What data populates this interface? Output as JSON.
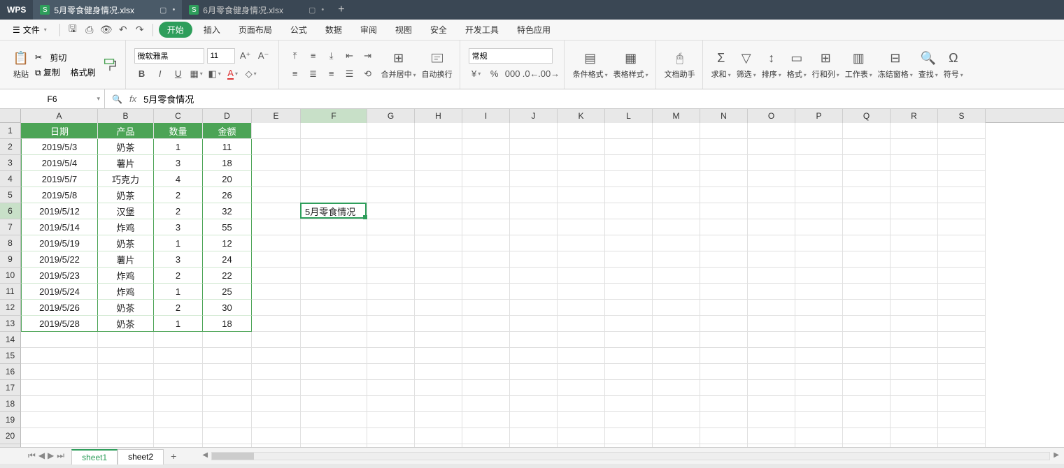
{
  "app": {
    "brand": "WPS"
  },
  "tabs": [
    {
      "label": "5月零食健身情况.xlsx",
      "active": true
    },
    {
      "label": "6月零食健身情况.xlsx",
      "active": false
    }
  ],
  "menu": {
    "file": "文件",
    "items": [
      "开始",
      "插入",
      "页面布局",
      "公式",
      "数据",
      "审阅",
      "视图",
      "安全",
      "开发工具",
      "特色应用"
    ],
    "active": "开始"
  },
  "qat": {
    "cut": "剪切",
    "copy": "复制",
    "format_painter": "格式刷",
    "paste": "粘贴"
  },
  "ribbon": {
    "font_name": "微软雅黑",
    "font_size": "11",
    "merge": "合并居中",
    "wrap": "自动换行",
    "number_format": "常规",
    "cond_fmt": "条件格式",
    "table_style": "表格样式",
    "doc_helper": "文档助手",
    "sum": "求和",
    "filter": "筛选",
    "sort": "排序",
    "format": "格式",
    "rowcol": "行和列",
    "worksheet": "工作表",
    "freeze": "冻结窗格",
    "find": "查找",
    "symbol": "符号"
  },
  "formula_bar": {
    "cell_ref": "F6",
    "value": "5月零食情况"
  },
  "columns": [
    "A",
    "B",
    "C",
    "D",
    "E",
    "F",
    "G",
    "H",
    "I",
    "J",
    "K",
    "L",
    "M",
    "N",
    "O",
    "P",
    "Q",
    "R",
    "S"
  ],
  "table": {
    "headers": [
      "日期",
      "产品",
      "数量",
      "金额"
    ],
    "rows": [
      [
        "2019/5/3",
        "奶茶",
        "1",
        "11"
      ],
      [
        "2019/5/4",
        "薯片",
        "3",
        "18"
      ],
      [
        "2019/5/7",
        "巧克力",
        "4",
        "20"
      ],
      [
        "2019/5/8",
        "奶茶",
        "2",
        "26"
      ],
      [
        "2019/5/12",
        "汉堡",
        "2",
        "32"
      ],
      [
        "2019/5/14",
        "炸鸡",
        "3",
        "55"
      ],
      [
        "2019/5/19",
        "奶茶",
        "1",
        "12"
      ],
      [
        "2019/5/22",
        "薯片",
        "3",
        "24"
      ],
      [
        "2019/5/23",
        "炸鸡",
        "2",
        "22"
      ],
      [
        "2019/5/24",
        "炸鸡",
        "1",
        "25"
      ],
      [
        "2019/5/26",
        "奶茶",
        "2",
        "30"
      ],
      [
        "2019/5/28",
        "奶茶",
        "1",
        "18"
      ]
    ]
  },
  "active_cell": {
    "ref": "F6",
    "text": "5月零食情况"
  },
  "sheets": {
    "items": [
      "sheet1",
      "sheet2"
    ],
    "active": "sheet1"
  },
  "row_count": 21
}
